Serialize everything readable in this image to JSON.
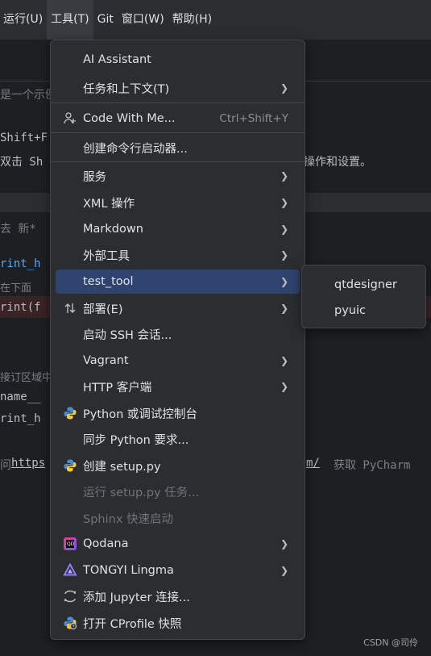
{
  "menubar": {
    "items": [
      "运行(U)",
      "工具(T)",
      "Git",
      "窗口(W)",
      "帮助(H)"
    ]
  },
  "editor": {
    "frag_example": "是一个示例",
    "frag_shift": "Shift+F",
    "frag_dblclick": "双击 Sh",
    "frag_dblclick_tail": "操作和设置。",
    "frag_tab": "去  新*",
    "frag_print1": "rint_h",
    "frag_below": "在下面",
    "frag_print2": "rint(f",
    "frag_gutter": "接订区域中",
    "frag_name": "name__",
    "frag_print3": "rint_h",
    "frag_url": "https",
    "frag_url2": "m/",
    "frag_url_tail": "获取 PyCharm",
    "frag_link_prefix": "问"
  },
  "menu": {
    "items": [
      {
        "label": "AI Assistant",
        "shortcut": "",
        "submenu": false,
        "icon": "",
        "state": "normal"
      },
      {
        "label": "任务和上下文(T)",
        "shortcut": "",
        "submenu": true,
        "icon": "",
        "state": "normal"
      },
      {
        "label": "Code With Me...",
        "shortcut": "Ctrl+Shift+Y",
        "submenu": false,
        "icon": "user-add-icon",
        "state": "normal"
      },
      {
        "label": "创建命令行启动器...",
        "shortcut": "",
        "submenu": false,
        "icon": "",
        "state": "normal"
      },
      {
        "label": "服务",
        "shortcut": "",
        "submenu": true,
        "icon": "",
        "state": "normal"
      },
      {
        "label": "XML 操作",
        "shortcut": "",
        "submenu": true,
        "icon": "",
        "state": "normal"
      },
      {
        "label": "Markdown",
        "shortcut": "",
        "submenu": true,
        "icon": "",
        "state": "normal"
      },
      {
        "label": "外部工具",
        "shortcut": "",
        "submenu": true,
        "icon": "",
        "state": "normal"
      },
      {
        "label": "test_tool",
        "shortcut": "",
        "submenu": true,
        "icon": "",
        "state": "selected"
      },
      {
        "label": "部署(E)",
        "shortcut": "",
        "submenu": true,
        "icon": "deploy-arrows-icon",
        "state": "normal"
      },
      {
        "label": "启动 SSH 会话...",
        "shortcut": "",
        "submenu": false,
        "icon": "",
        "state": "normal"
      },
      {
        "label": "Vagrant",
        "shortcut": "",
        "submenu": true,
        "icon": "",
        "state": "normal"
      },
      {
        "label": "HTTP 客户端",
        "shortcut": "",
        "submenu": true,
        "icon": "",
        "state": "normal"
      },
      {
        "label": "Python 或调试控制台",
        "shortcut": "",
        "submenu": false,
        "icon": "python-icon",
        "state": "normal"
      },
      {
        "label": "同步 Python 要求...",
        "shortcut": "",
        "submenu": false,
        "icon": "",
        "state": "normal"
      },
      {
        "label": "创建 setup.py",
        "shortcut": "",
        "submenu": false,
        "icon": "python-icon",
        "state": "normal"
      },
      {
        "label": "运行 setup.py 任务...",
        "shortcut": "",
        "submenu": false,
        "icon": "",
        "state": "disabled"
      },
      {
        "label": "Sphinx 快速启动",
        "shortcut": "",
        "submenu": false,
        "icon": "",
        "state": "disabled"
      },
      {
        "label": "Qodana",
        "shortcut": "",
        "submenu": true,
        "icon": "qodana-icon",
        "state": "normal"
      },
      {
        "label": "TONGYI Lingma",
        "shortcut": "",
        "submenu": true,
        "icon": "lingma-icon",
        "state": "normal"
      },
      {
        "label": "添加 Jupyter 连接...",
        "shortcut": "",
        "submenu": false,
        "icon": "jupyter-icon",
        "state": "normal"
      },
      {
        "label": "打开 CProfile 快照",
        "shortcut": "",
        "submenu": false,
        "icon": "cprofile-icon",
        "state": "normal"
      }
    ]
  },
  "submenu": {
    "items": [
      "qtdesigner",
      "pyuic"
    ]
  },
  "watermark": "CSDN @司伶",
  "colors": {
    "background": "#1e1f22",
    "menu_bg": "#2b2d30",
    "selection": "#2e436e",
    "disabled_text": "#6f737a"
  }
}
